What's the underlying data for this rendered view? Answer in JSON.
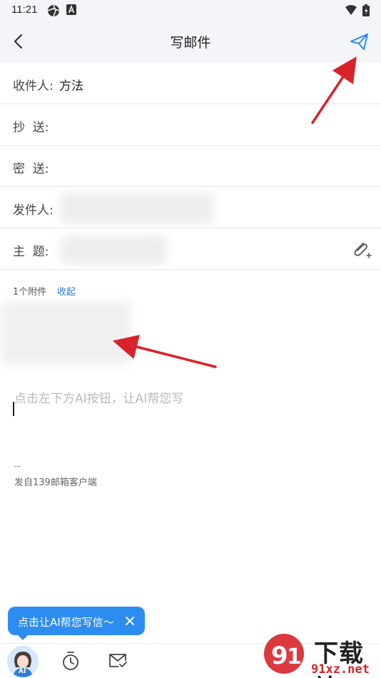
{
  "status_bar": {
    "time": "11:21",
    "icons": [
      "aperture-icon",
      "font-a-icon",
      "wifi-icon",
      "battery-charging-icon"
    ]
  },
  "header": {
    "title": "写邮件",
    "back_icon": "chevron-left-icon",
    "send_icon": "paper-plane-icon"
  },
  "fields": {
    "to": {
      "label": "收件人:",
      "value": "方法"
    },
    "cc": {
      "label": "抄  送:",
      "value": ""
    },
    "bcc": {
      "label": "密  送:",
      "value": ""
    },
    "from": {
      "label": "发件人:",
      "value": ""
    },
    "subject": {
      "label": "主  题:",
      "value": "",
      "attach_icon": "paperclip-plus-icon"
    }
  },
  "attachments": {
    "count_text": "1个附件",
    "collapse_label": "收起"
  },
  "body": {
    "placeholder": "点击左下方AI按钮，让AI帮您写",
    "signature_dash": "--",
    "signature": "发自139邮箱客户端"
  },
  "ai_tooltip": {
    "text": "点击让AI帮您写信～",
    "close_icon": "close-icon"
  },
  "bottom_bar": {
    "avatar_label": "AI",
    "timer_icon": "timer-icon",
    "mail_check_icon": "mail-check-icon"
  },
  "watermark": {
    "title": "下载站",
    "url": "91xz.net"
  },
  "colors": {
    "accent": "#2d8cf0",
    "link": "#1f7bdc",
    "annotation_arrow": "#d8232a",
    "header_bg": "#f4f5f9"
  }
}
